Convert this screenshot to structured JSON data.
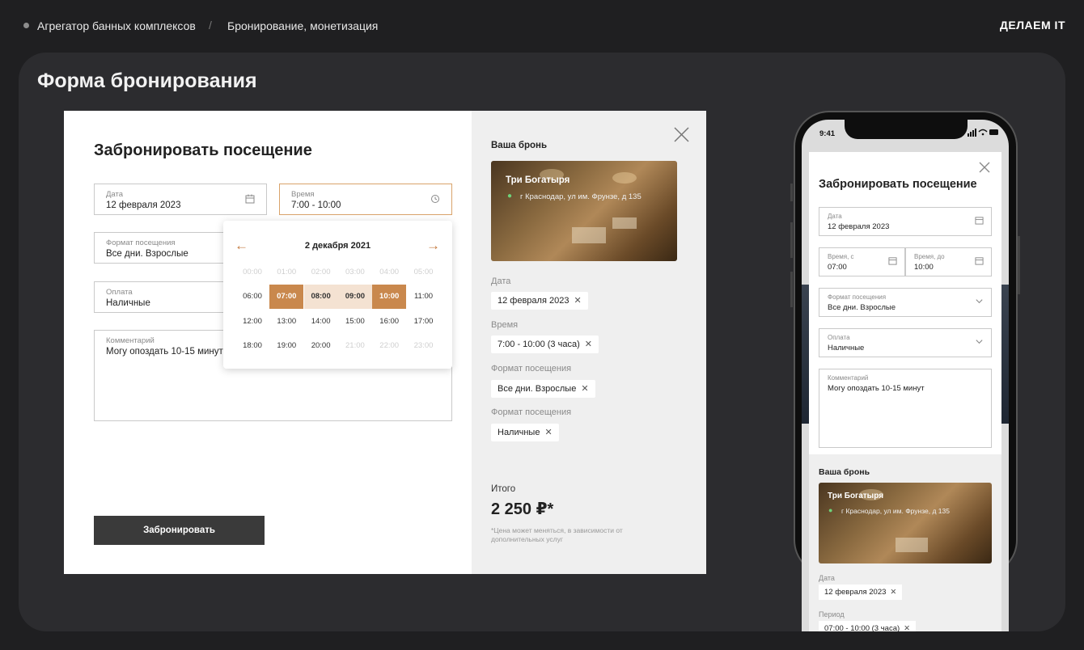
{
  "breadcrumb": {
    "item1": "Агрегатор банных комплексов",
    "separator": "/",
    "item2": "Бронирование, монетизация"
  },
  "logo": "ДЕЛАЕМ IT",
  "section_title": "Форма бронирования",
  "desktop": {
    "title": "Забронировать посещение",
    "date": {
      "label": "Дата",
      "value": "12 февраля 2023",
      "icon": "calendar-icon"
    },
    "time": {
      "label": "Время",
      "value": "7:00 - 10:00",
      "icon": "clock-icon"
    },
    "format": {
      "label": "Формат посещения",
      "value": "Все дни. Взрослые"
    },
    "payment": {
      "label": "Оплата",
      "value": "Наличные"
    },
    "comment": {
      "label": "Комментарий",
      "value": "Могу опоздать 10-15 минут"
    },
    "submit": "Забронировать",
    "picker": {
      "title": "2 декабря 2021",
      "prev_icon": "arrow-left-icon",
      "next_icon": "arrow-right-icon",
      "slots": [
        {
          "t": "00:00",
          "state": "disabled"
        },
        {
          "t": "01:00",
          "state": "disabled"
        },
        {
          "t": "02:00",
          "state": "disabled"
        },
        {
          "t": "03:00",
          "state": "disabled"
        },
        {
          "t": "04:00",
          "state": "disabled"
        },
        {
          "t": "05:00",
          "state": "disabled"
        },
        {
          "t": "06:00",
          "state": "normal"
        },
        {
          "t": "07:00",
          "state": "selected"
        },
        {
          "t": "08:00",
          "state": "range"
        },
        {
          "t": "09:00",
          "state": "range"
        },
        {
          "t": "10:00",
          "state": "selected"
        },
        {
          "t": "11:00",
          "state": "normal"
        },
        {
          "t": "12:00",
          "state": "normal"
        },
        {
          "t": "13:00",
          "state": "normal"
        },
        {
          "t": "14:00",
          "state": "normal"
        },
        {
          "t": "15:00",
          "state": "normal"
        },
        {
          "t": "16:00",
          "state": "normal"
        },
        {
          "t": "17:00",
          "state": "normal"
        },
        {
          "t": "18:00",
          "state": "normal"
        },
        {
          "t": "19:00",
          "state": "normal"
        },
        {
          "t": "20:00",
          "state": "normal"
        },
        {
          "t": "21:00",
          "state": "disabled"
        },
        {
          "t": "22:00",
          "state": "disabled"
        },
        {
          "t": "23:00",
          "state": "disabled"
        }
      ]
    },
    "summary": {
      "heading": "Ваша бронь",
      "place_name": "Три Богатыря",
      "place_address": "г Краснодар, ул им. Фрунзе, д 135",
      "date_label": "Дата",
      "date_chip": "12 февраля 2023",
      "time_label": "Время",
      "time_chip": "7:00 - 10:00 (3 часа)",
      "format_label": "Формат посещения",
      "format_chip": "Все дни. Взрослые",
      "payment_label": "Формат посещения",
      "payment_chip": "Наличные",
      "total_label": "Итого",
      "total_value": "2 250 ₽*",
      "note": "*Цена может меняться, в зависимости от дополнительных услуг"
    }
  },
  "mobile": {
    "status_time": "9:41",
    "title": "Забронировать посещение",
    "date": {
      "label": "Дата",
      "value": "12 февраля 2023"
    },
    "time_from": {
      "label": "Время, с",
      "value": "07:00"
    },
    "time_to": {
      "label": "Время, до",
      "value": "10:00"
    },
    "format": {
      "label": "Формат посещения",
      "value": "Все дни. Взрослые"
    },
    "payment": {
      "label": "Оплата",
      "value": "Наличные"
    },
    "comment": {
      "label": "Комментарий",
      "value": "Могу опоздать 10-15 минут"
    },
    "summary": {
      "heading": "Ваша бронь",
      "place_name": "Три Богатыря",
      "place_address": "г Краснодар, ул им. Фрунзе, д 135",
      "date_label": "Дата",
      "date_chip": "12 февраля 2023",
      "period_label": "Период",
      "period_chip": "07:00 - 10:00 (3 часа)"
    }
  }
}
